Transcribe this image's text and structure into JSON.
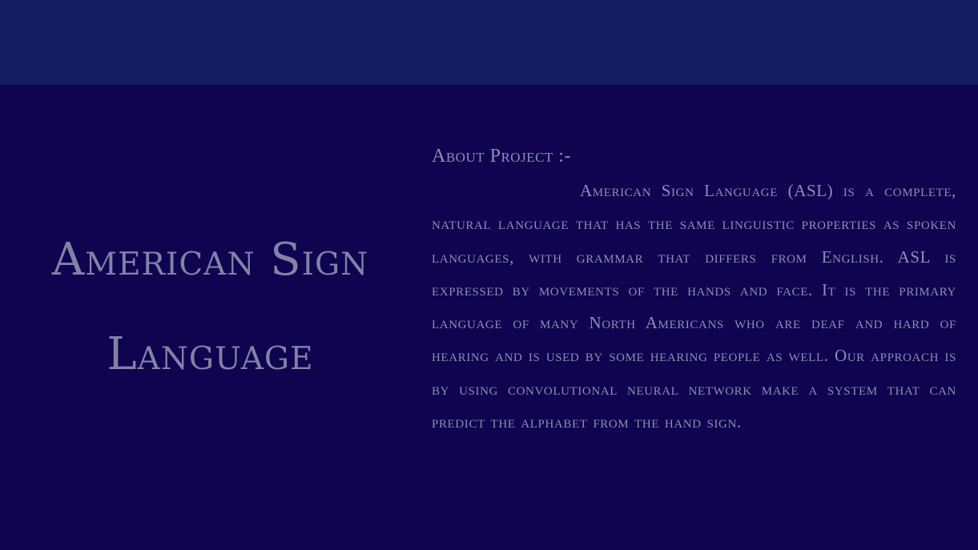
{
  "hero": {
    "title": "American Sign Language"
  },
  "about": {
    "heading": "About Project :-",
    "text": "American Sign Language (ASL) is a complete, natural language that has the same linguistic properties as spoken languages, with grammar that differs from English. ASL is expressed by movements of the hands and face. It is the primary language of many North Americans who are deaf and hard of hearing and is used by some hearing people as well. Our approach is by using convolutional neural network make a system that can predict the alphabet from the hand sign."
  },
  "colors": {
    "top_bar": "#141c62",
    "background": "#100350",
    "title_text": "#8183a6",
    "body_text": "#8c8eb1"
  }
}
